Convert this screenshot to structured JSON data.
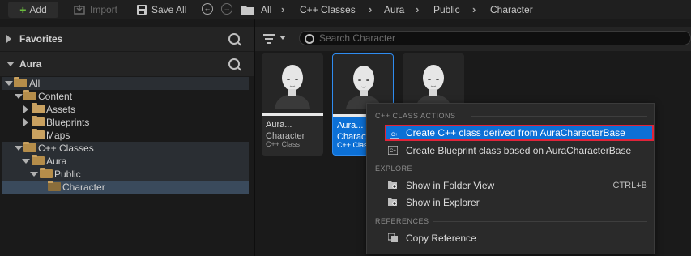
{
  "toolbar": {
    "add_label": "Add",
    "import_label": "Import",
    "save_all_label": "Save All"
  },
  "breadcrumb": [
    "All",
    "C++ Classes",
    "Aura",
    "Public",
    "Character"
  ],
  "sidebar": {
    "favorites_label": "Favorites",
    "project_label": "Aura",
    "tree": [
      {
        "label": "All"
      },
      {
        "label": "Content"
      },
      {
        "label": "Assets"
      },
      {
        "label": "Blueprints"
      },
      {
        "label": "Maps"
      },
      {
        "label": "C++ Classes"
      },
      {
        "label": "Aura"
      },
      {
        "label": "Public"
      },
      {
        "label": "Character"
      }
    ]
  },
  "search": {
    "placeholder": "Search Character"
  },
  "assets": [
    {
      "name": "Aura...",
      "type": "Character",
      "parent_type": "C++ Class"
    },
    {
      "name": "Aura...",
      "type": "Character",
      "parent_type": "C++ Class"
    }
  ],
  "context_menu": {
    "section_cpp": "C++ CLASS ACTIONS",
    "create_cpp_label": "Create C++ class derived from AuraCharacterBase",
    "create_bp_label": "Create Blueprint class based on AuraCharacterBase",
    "section_explore": "EXPLORE",
    "show_folder_label": "Show in Folder View",
    "show_folder_shortcut": "CTRL+B",
    "show_explorer_label": "Show in Explorer",
    "section_references": "REFERENCES",
    "copy_reference_label": "Copy Reference"
  },
  "colors": {
    "accent": "#0c70d6",
    "highlight_border": "#e0243a",
    "folder": "#c9a160"
  }
}
